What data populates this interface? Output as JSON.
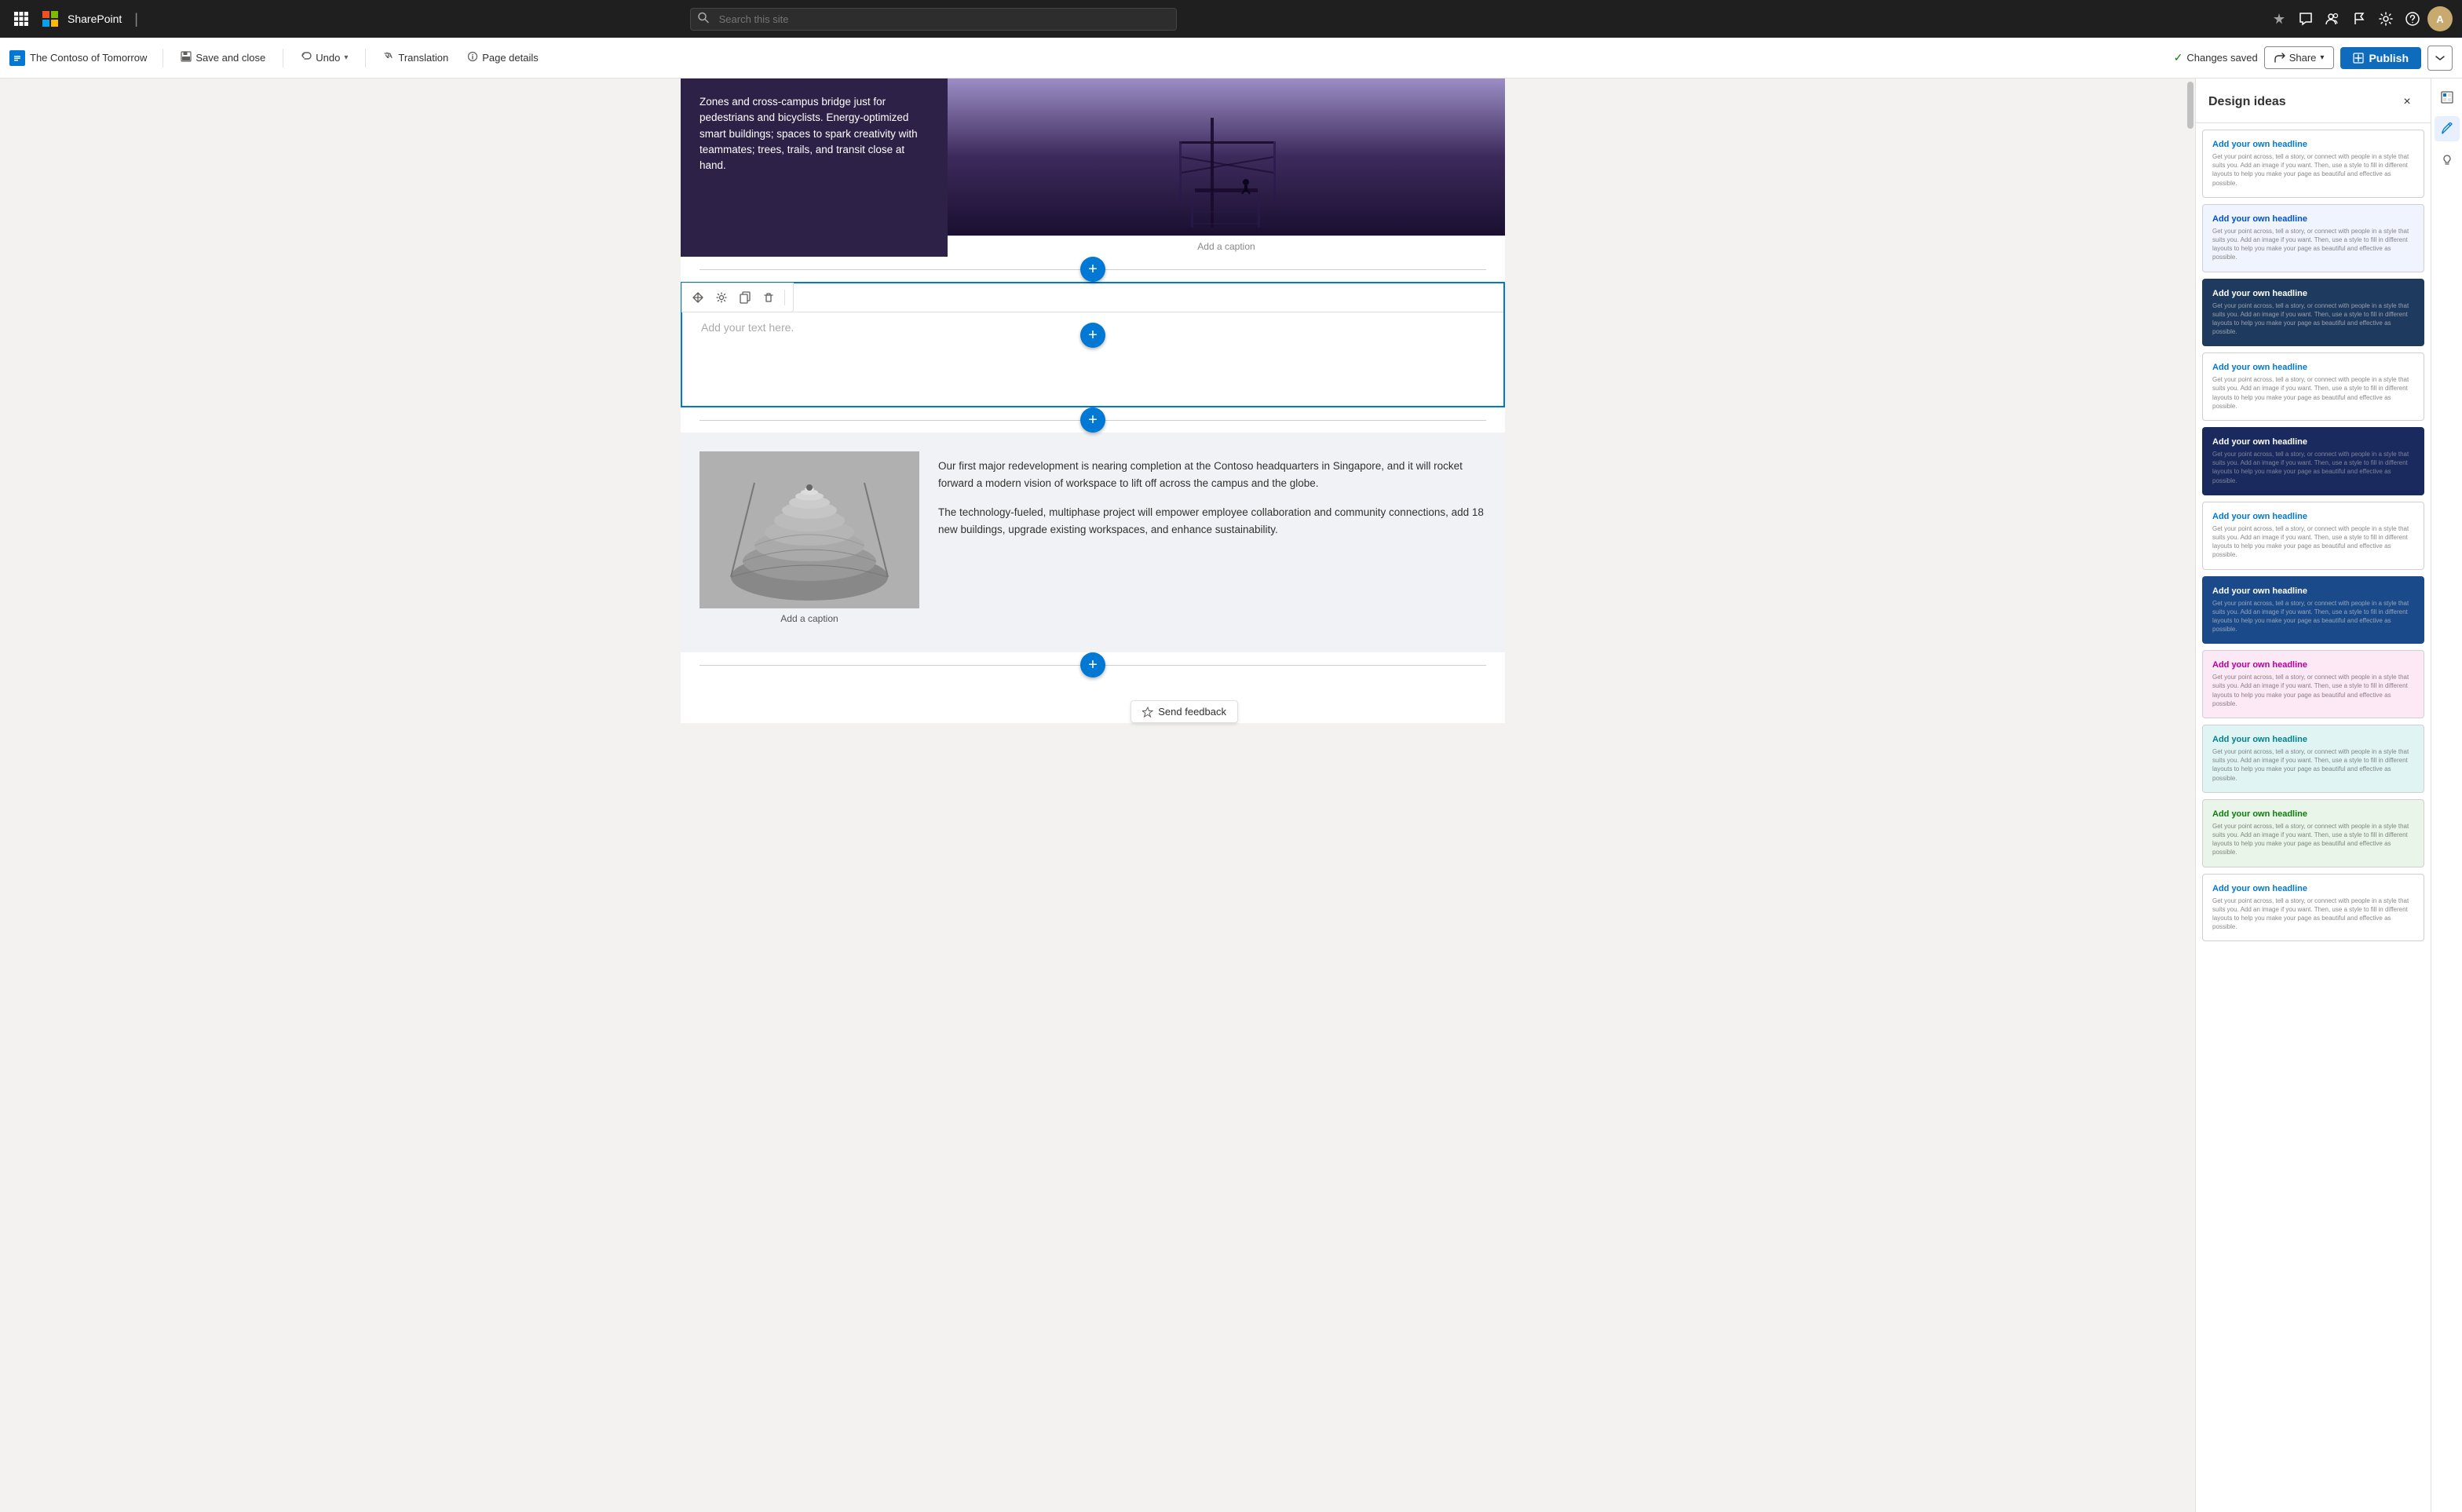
{
  "app": {
    "waffle_icon": "⊞",
    "ms_logo_colors": [
      "#f25022",
      "#7fba00",
      "#00a4ef",
      "#ffb900"
    ],
    "app_name": "SharePoint",
    "divider": "|"
  },
  "nav": {
    "search_placeholder": "Search this site",
    "icons": {
      "help": "?",
      "settings": "⚙",
      "feedback": "💬",
      "copilot": "✦",
      "community": "👥",
      "flag": "⚑",
      "avatar_initials": "A"
    }
  },
  "toolbar": {
    "brand_icon": "S",
    "brand_label": "The Contoso of Tomorrow",
    "save_close_label": "Save and close",
    "undo_label": "Undo",
    "translation_label": "Translation",
    "page_details_label": "Page details",
    "changes_saved_label": "Changes saved",
    "share_label": "Share",
    "publish_label": "Publish"
  },
  "editor": {
    "add_text_placeholder": "Add your text here.",
    "add_caption_1": "Add a caption",
    "add_caption_2": "Add a caption",
    "top_text": "Zones and cross-campus bridge just for pedestrians and bicyclists. Energy-optimized smart buildings; spaces to spark creativity with teammates; trees, trails, and transit close at hand.",
    "para_1": "Our first major redevelopment is nearing completion at the Contoso headquarters in Singapore, and it will rocket forward a modern vision of workspace to lift off across the campus and the globe.",
    "para_2": "The technology-fueled, multiphase project will empower employee collaboration and community connections, add 18 new buildings, upgrade existing workspaces, and enhance sustainability.",
    "send_feedback_label": "Send feedback"
  },
  "design_ideas": {
    "panel_title": "Design ideas",
    "close_btn": "×",
    "cards": [
      {
        "id": 1,
        "style": "white-bg",
        "headline": "Add your own headline",
        "text": "Get your point across, tell a story, or connect with people in a style that suits you. Add an image if you want. Then, use a style to fill in different layouts to help you make your page as beautiful and effective as possible."
      },
      {
        "id": 2,
        "style": "white-bg-blue",
        "headline": "Add your own headline",
        "text": "Get your point across, tell a story, or connect with people in a style that suits you. Add an image if you want. Then, use a style to fill in different layouts to help you make your page as beautiful and effective as possible."
      },
      {
        "id": 3,
        "style": "dark-blue-bg",
        "headline": "Add your own headline",
        "text": "Get your point across, tell a story, or connect with people in a style that suits you. Add an image if you want. Then, use a style to fill in different layouts to help you make your page as beautiful and effective as possible."
      },
      {
        "id": 4,
        "style": "white-bg",
        "headline": "Add your own headline",
        "text": "Get your point across, tell a story, or connect with people in a style that suits you. Add an image if you want. Then, use a style to fill in different layouts to help you make your page as beautiful and effective as possible."
      },
      {
        "id": 5,
        "style": "navy-bg",
        "headline": "Add your own headline",
        "text": "Get your point across, tell a story, or connect with people in a style that suits you. Add an image if you want. Then, use a style to fill in different layouts to help you make your page as beautiful and effective as possible."
      },
      {
        "id": 6,
        "style": "white-bg",
        "headline": "Add your own headline",
        "text": "Get your point across, tell a story, or connect with people in a style that suits you. Add an image if you want. Then, use a style to fill in different layouts to help you make your page as beautiful and effective as possible."
      },
      {
        "id": 7,
        "style": "blue-bg",
        "headline": "Add your own headline",
        "text": "Get your point across, tell a story, or connect with people in a style that suits you. Add an image if you want. Then, use a style to fill in different layouts to help you make your page as beautiful and effective as possible."
      },
      {
        "id": 8,
        "style": "pink-light-bg",
        "headline": "Add your own headline",
        "text": "Get your point across, tell a story, or connect with people in a style that suits you. Add an image if you want. Then, use a style to fill in different layouts to help you make your page as beautiful and effective as possible."
      },
      {
        "id": 9,
        "style": "teal-light-bg",
        "headline": "Add your own headline",
        "text": "Get your point across, tell a story, or connect with people in a style that suits you. Add an image if you want. Then, use a style to fill in different layouts to help you make your page as beautiful and effective as possible."
      },
      {
        "id": 10,
        "style": "green-light-bg",
        "headline": "Add your own headline",
        "text": "Get your point across, tell a story, or connect with people in a style that suits you. Add an image if you want. Then, use a style to fill in different layouts to help you make your page as beautiful and effective as possible."
      },
      {
        "id": 11,
        "style": "white-bg",
        "headline": "Add your own headline",
        "text": "Get your point across, tell a story, or connect with people in a style that suits you. Add an image if you want. Then, use a style to fill in different layouts to help you make your page as beautiful and effective as possible."
      }
    ]
  },
  "right_sidebar": {
    "icons": [
      "🎨",
      "↔",
      "💡"
    ]
  }
}
